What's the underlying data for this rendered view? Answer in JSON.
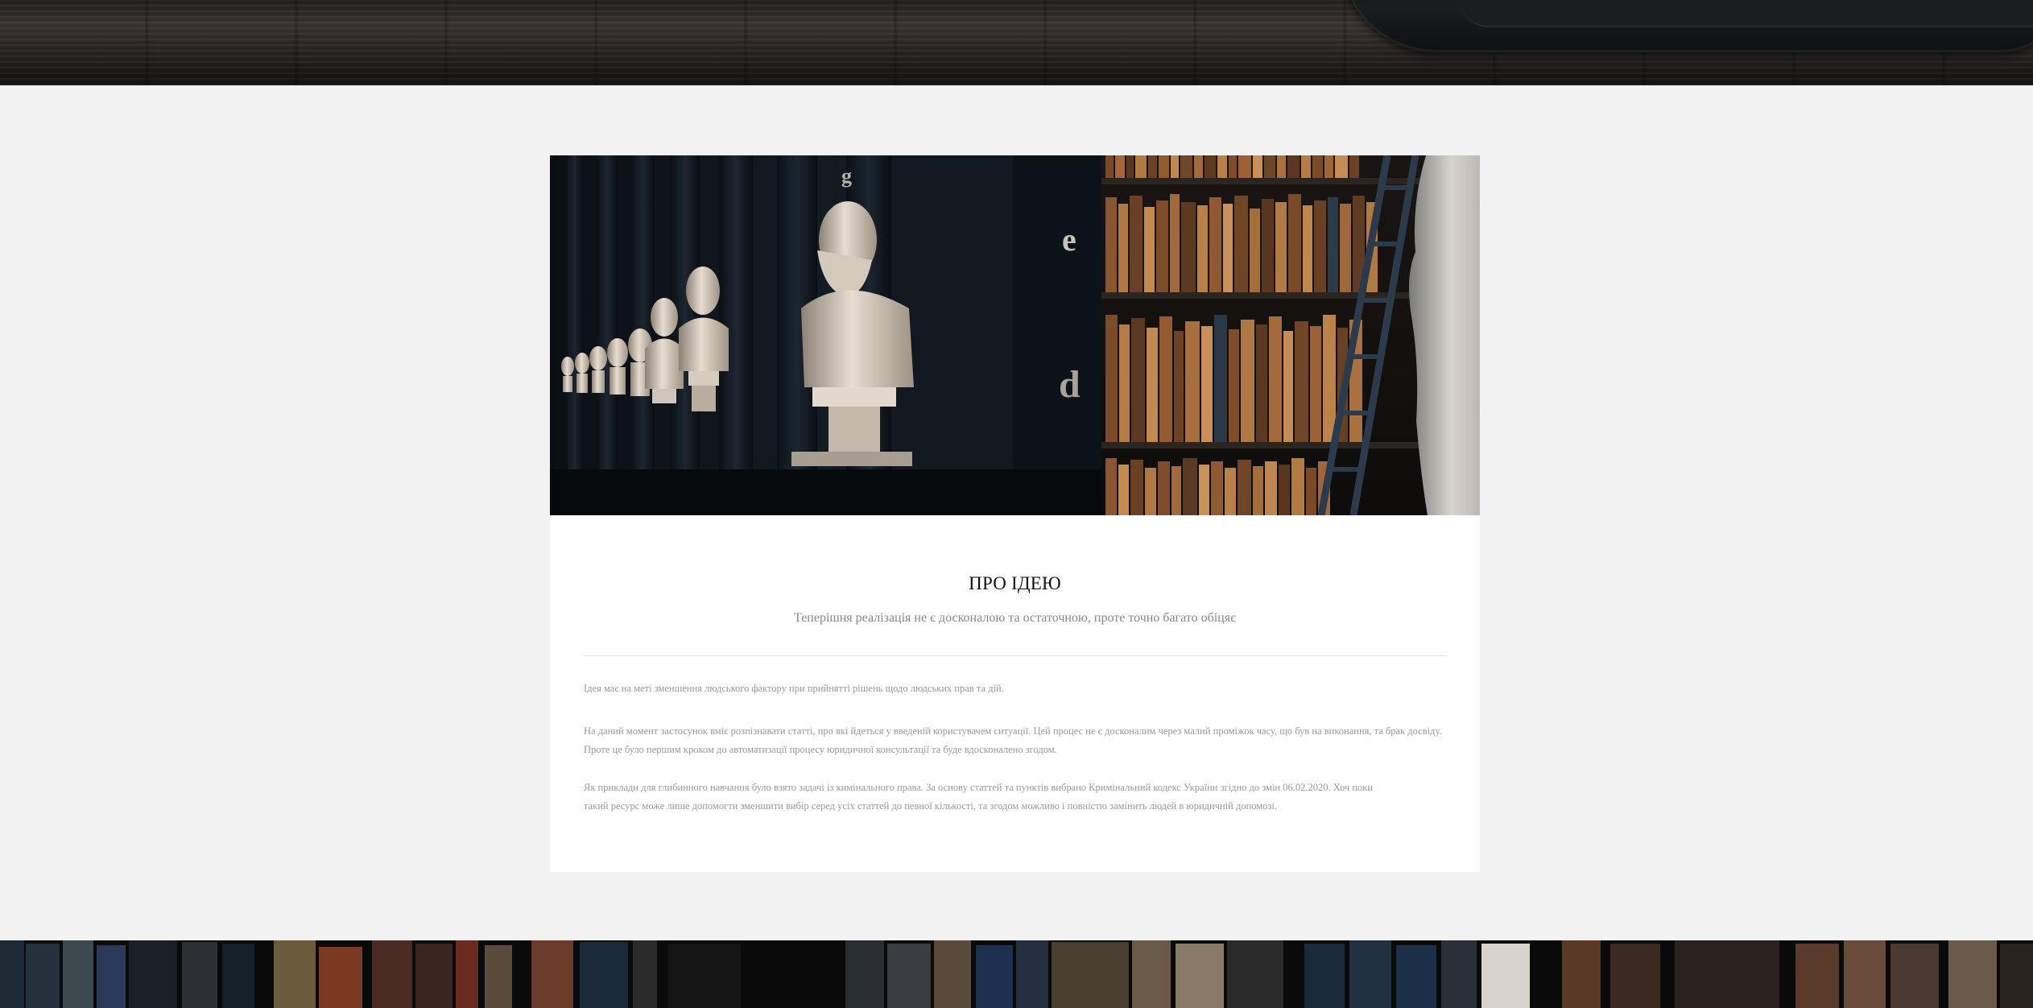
{
  "about": {
    "title": "ПРО ІДЕЮ",
    "subtitle": "Теперішня реалізація не є досконалою та остаточною, проте точно багато обіцяє",
    "paragraphs": [
      "Ідея має на меті зменшення людського фактору при прийнятті рішень щодо людських прав та дій.",
      "На даний момент застосунок вміє розпізнавати статті, про які йдеться у введеній користувачем ситуації. Цей процес не є досконалим через малий проміжок часу, що був на виконання, та брак досвіду. Проте це було першим кроком до автоматизації процесу юридичної консультації та буде вдосконалено згодом.",
      "Як приклади для глибинного навчання було взято задачі із кимінального права. За основу статтей та пунктів вибрано Кримінальний кодекс України згідно до змін 06.02.2020. Хоч поки такий ресурс може лише допомогти зменшити вибір серед усіх статтей до певної кількості, та згодом можливо і повністю замінить людей в юридичній допомозі."
    ]
  },
  "hero": {
    "letters": [
      "g",
      "e",
      "d"
    ]
  },
  "colors": {
    "page_background": "#f2f2f2",
    "card_background": "#ffffff",
    "title_text": "#111111",
    "muted_text": "#888888",
    "paragraph_text": "#9a9a9a"
  }
}
